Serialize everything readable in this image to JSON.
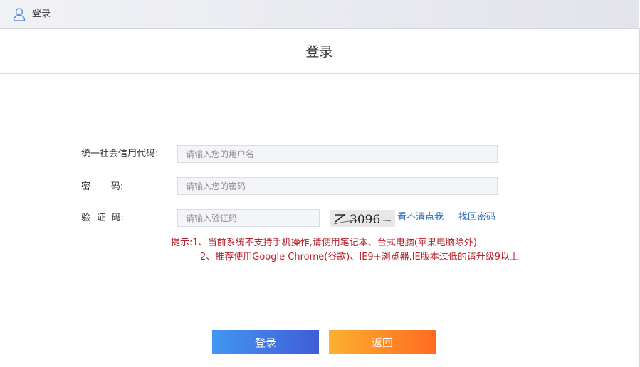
{
  "topbar": {
    "title": "登录",
    "icon": "user-icon"
  },
  "page_title": "登录",
  "form": {
    "usci_label": "统一社会信用代码:",
    "usci_placeholder": "请输入您的用户名",
    "password_label": "密       码:",
    "password_placeholder": "请输入您的密码",
    "captcha_label": "验  证  码:",
    "captcha_placeholder": "请输入验证码",
    "captcha_text": "3096",
    "refresh_captcha_link": "看不清点我",
    "forgot_password_link": "找回密码"
  },
  "tips": {
    "line1": "提示:1、当前系统不支持手机操作,请使用笔记本、台式电脑(苹果电脑除外)",
    "line2": "2、推荐使用Google Chrome(谷歌)、IE9+浏览器,IE版本过低的请升级9以上"
  },
  "buttons": {
    "login": "登录",
    "back": "返回"
  },
  "colors": {
    "tip_text": "#b8202a",
    "link": "#2f6fc0",
    "login_gradient_start": "#4396f3",
    "login_gradient_end": "#3f5dd6",
    "back_gradient_start": "#fdb12f",
    "back_gradient_end": "#ff6a22"
  }
}
